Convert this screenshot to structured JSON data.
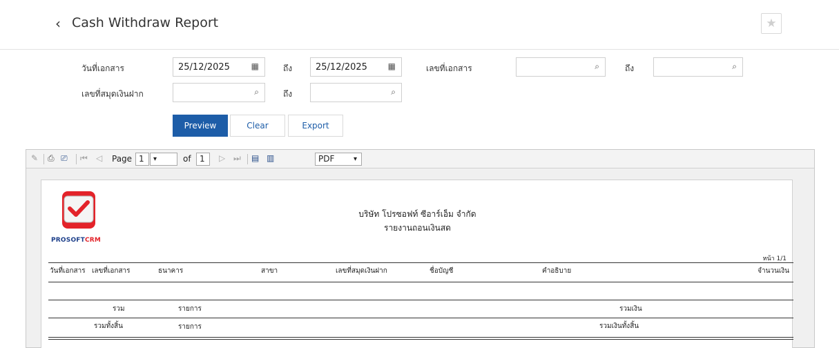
{
  "header": {
    "back_icon": "chevron-left-icon",
    "title": "Cash Withdraw Report",
    "favorite_icon": "star-icon"
  },
  "filters": {
    "doc_date_label": "วันที่เอกสาร",
    "doc_date_from": "25/12/2025",
    "to_label": "ถึง",
    "doc_date_to": "25/12/2025",
    "doc_no_label": "เลขที่เอกสาร",
    "doc_no_from": "",
    "doc_no_to": "",
    "passbook_label": "เลขที่สมุดเงินฝาก",
    "passbook_from": "",
    "passbook_to": ""
  },
  "actions": {
    "preview": "Preview",
    "clear": "Clear",
    "export": "Export"
  },
  "viewer": {
    "page_label": "Page",
    "page_value": "1",
    "of_label": "of",
    "total_pages": "1",
    "format": "PDF"
  },
  "report": {
    "logo_text_1": "PROSOFT",
    "logo_text_2": "CRM",
    "company": "บริษัท โปรซอฟท์ ซีอาร์เอ็ม จำกัด",
    "title": "รายงานถอนเงินสด",
    "page_no": "หน้า 1/1",
    "columns": {
      "doc_date": "วันที่เอกสาร",
      "doc_no": "เลขที่เอกสาร",
      "bank": "ธนาคาร",
      "branch": "สาขา",
      "passbook": "เลขที่สมุดเงินฝาก",
      "account_name": "ชื่อบัญชี",
      "description": "คำอธิบาย",
      "amount": "จำนวนเงิน"
    },
    "subtotal": {
      "label": "รวม",
      "items": "รายการ",
      "amount_label": "รวมเงิน"
    },
    "grand_total": {
      "label": "รวมทั้งสิ้น",
      "items": "รายการ",
      "amount_label": "รวมเงินทั้งสิ้น"
    }
  },
  "colors": {
    "primary": "#1d5da8",
    "logo_red": "#e3232a"
  }
}
